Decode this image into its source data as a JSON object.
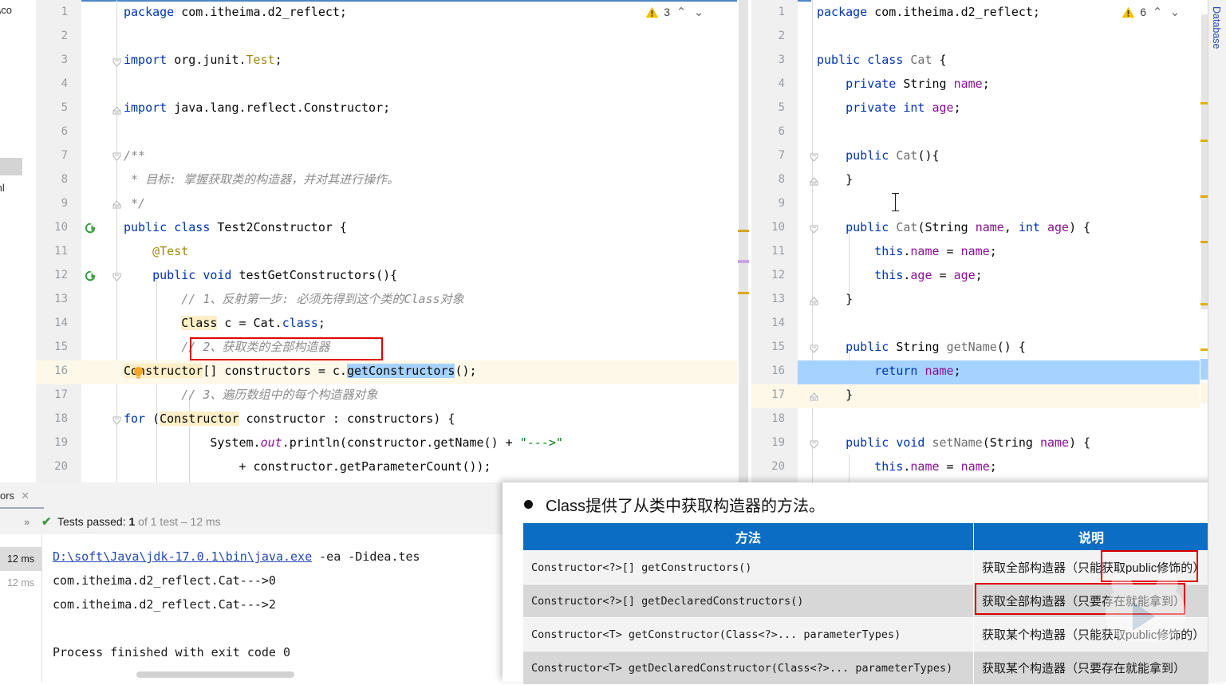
{
  "app": {
    "left_panel_texts": [
      ":\\co",
      "ml"
    ],
    "right_tool_tab": "Database"
  },
  "left_editor": {
    "warning_icon": "warning-triangle-icon",
    "warning_count": "3",
    "up_icon": "chevron-up-icon",
    "down_icon": "chevron-down-icon",
    "annotation_box_label": "red-highlight-line-15",
    "lines": [
      {
        "n": "1",
        "code": "package com.itheima.d2_reflect;"
      },
      {
        "n": "2",
        "code": ""
      },
      {
        "n": "3",
        "code": "import org.junit.Test;"
      },
      {
        "n": "4",
        "code": ""
      },
      {
        "n": "5",
        "code": "import java.lang.reflect.Constructor;"
      },
      {
        "n": "6",
        "code": ""
      },
      {
        "n": "7",
        "code": "/**"
      },
      {
        "n": "8",
        "code": " * 目标: 掌握获取类的构造器，并对其进行操作。"
      },
      {
        "n": "9",
        "code": " */"
      },
      {
        "n": "10",
        "code": "public class Test2Constructor {"
      },
      {
        "n": "11",
        "code": "    @Test"
      },
      {
        "n": "12",
        "code": "    public void testGetConstructors(){"
      },
      {
        "n": "13",
        "code": "        // 1、反射第一步: 必须先得到这个类的Class对象"
      },
      {
        "n": "14",
        "code": "        Class c = Cat.class;"
      },
      {
        "n": "15",
        "code": "        // 2、获取类的全部构造器"
      },
      {
        "n": "16",
        "code": "        Constructor[] constructors = c.getConstructors();"
      },
      {
        "n": "17",
        "code": "        // 3、遍历数组中的每个构造器对象"
      },
      {
        "n": "18",
        "code": "        for (Constructor constructor : constructors) {"
      },
      {
        "n": "19",
        "code": "            System.out.println(constructor.getName() + \"--->\""
      },
      {
        "n": "20",
        "code": "                + constructor.getParameterCount());"
      }
    ]
  },
  "right_editor": {
    "warning_icon": "warning-triangle-icon",
    "warning_count": "6",
    "up_icon": "chevron-up-icon",
    "down_icon": "chevron-down-icon",
    "lines": [
      {
        "n": "1",
        "code": "package com.itheima.d2_reflect;"
      },
      {
        "n": "2",
        "code": ""
      },
      {
        "n": "3",
        "code": "public class Cat {"
      },
      {
        "n": "4",
        "code": "    private String name;"
      },
      {
        "n": "5",
        "code": "    private int age;"
      },
      {
        "n": "6",
        "code": ""
      },
      {
        "n": "7",
        "code": "    public Cat(){"
      },
      {
        "n": "8",
        "code": "    }"
      },
      {
        "n": "9",
        "code": ""
      },
      {
        "n": "10",
        "code": "    public Cat(String name, int age) {"
      },
      {
        "n": "11",
        "code": "        this.name = name;"
      },
      {
        "n": "12",
        "code": "        this.age = age;"
      },
      {
        "n": "13",
        "code": "    }"
      },
      {
        "n": "14",
        "code": ""
      },
      {
        "n": "15",
        "code": "    public String getName() {"
      },
      {
        "n": "16",
        "code": "        return name;"
      },
      {
        "n": "17",
        "code": "    }"
      },
      {
        "n": "18",
        "code": ""
      },
      {
        "n": "19",
        "code": "    public void setName(String name) {"
      },
      {
        "n": "20",
        "code": "        this.name = name;"
      }
    ]
  },
  "bottom_panel": {
    "tab_label": "ors",
    "close_icon": "close-icon",
    "expand_icon": "expand-all-icon",
    "status_check_icon": "check-icon",
    "status_prefix": "Tests passed: ",
    "status_count": "1",
    "status_suffix": " of 1 test – 12 ms",
    "time_cells": [
      "12 ms",
      "12 ms"
    ],
    "console": [
      {
        "link": "D:\\soft\\Java\\jdk-17.0.1\\bin\\java.exe",
        "rest": " -ea -Didea.tes"
      },
      {
        "link": "",
        "rest": "com.itheima.d2_reflect.Cat--->0"
      },
      {
        "link": "",
        "rest": "com.itheima.d2_reflect.Cat--->2"
      },
      {
        "link": "",
        "rest": ""
      },
      {
        "link": "",
        "rest": "Process finished with exit code 0"
      }
    ]
  },
  "slide": {
    "bullet_text": "Class提供了从类中获取构造器的方法。",
    "bullet_icon": "bullet-dot-icon",
    "table": {
      "headers": [
        "方法",
        "说明"
      ],
      "rows": [
        [
          "Constructor<?>[] getConstructors()",
          "获取全部构造器（只能获取public修饰的）"
        ],
        [
          "Constructor<?>[] getDeclaredConstructors()",
          "获取全部构造器（只要存在就能拿到）"
        ],
        [
          "Constructor<T> getConstructor(Class<?>... parameterTypes)",
          "获取某个构造器（只能获取public修饰的）"
        ],
        [
          "Constructor<T> getDeclaredConstructor(Class<?>... parameterTypes)",
          "获取某个构造器（只要存在就能拿到）"
        ]
      ]
    },
    "watermark_icon": "play-button-watermark-icon"
  }
}
